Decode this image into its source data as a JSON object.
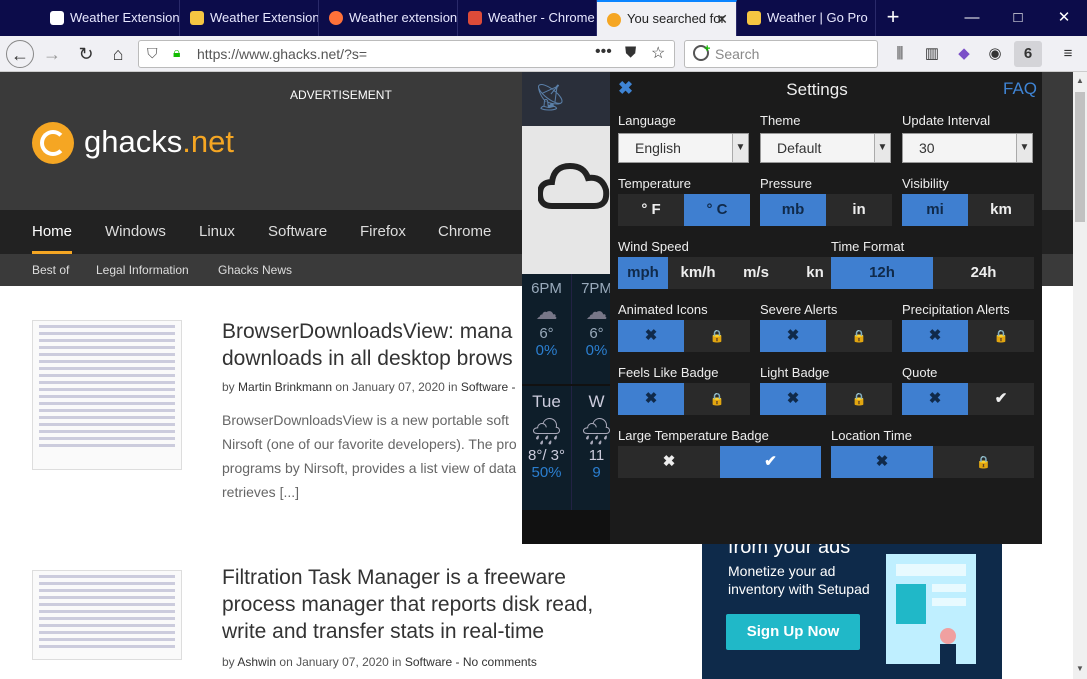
{
  "tabs": [
    {
      "label": "Weather Extension",
      "icon_color": "#ffffff",
      "active": false
    },
    {
      "label": "Weather Extension",
      "icon_color": "#f5c542",
      "active": false
    },
    {
      "label": "Weather extension",
      "icon_color": "#ff7139",
      "active": false
    },
    {
      "label": "Weather - Chrome",
      "icon_color": "#dd4b39",
      "active": false
    },
    {
      "label": "You searched for",
      "icon_color": "#f5a623",
      "active": true
    },
    {
      "label": "Weather | Go Pro",
      "icon_color": "#f5c542",
      "active": false
    }
  ],
  "window": {
    "new_tab": "+",
    "minimize": "—",
    "maximize": "□",
    "close": "✕"
  },
  "navbar": {
    "url": "https://www.ghacks.net/?s=",
    "search_placeholder": "Search",
    "badge": "6"
  },
  "page": {
    "advertisement": "ADVERTISEMENT",
    "logo_prefix": "ghacks",
    "logo_suffix": ".net",
    "nav": [
      "Home",
      "Windows",
      "Linux",
      "Software",
      "Firefox",
      "Chrome"
    ],
    "subnav": [
      "Best of",
      "Legal Information",
      "Ghacks News"
    ],
    "articles": [
      {
        "title_line1": "BrowserDownloadsView: mana",
        "title_line2": "downloads in all desktop brows",
        "by": "by",
        "author": "Martin Brinkmann",
        "on": "on January 07, 2020 in",
        "category": "Software -",
        "body": [
          "BrowserDownloadsView is a new portable soft",
          "Nirsoft (one of our favorite developers). The pro",
          "programs by Nirsoft, provides a list view of data",
          "retrieves [...]"
        ]
      },
      {
        "title_line1": "Filtration Task Manager is a freeware",
        "title_line2": "process manager that reports disk read,",
        "title_line3": "write and transfer stats in real-time",
        "by": "by",
        "author": "Ashwin",
        "on": "on January 07, 2020 in",
        "category": "Software -",
        "comments": "No comments"
      }
    ],
    "ad": {
      "headline": "from your ads",
      "sub": "Monetize your ad inventory with Setupad",
      "button": "Sign Up Now"
    }
  },
  "weather": {
    "hours": [
      {
        "time": "6PM",
        "temp": "6°",
        "precip": "0%"
      },
      {
        "time": "7PM",
        "temp": "6°",
        "precip": "0%"
      }
    ],
    "days": [
      {
        "day": "Tue",
        "temp": "8°/ 3°",
        "precip": "50%"
      },
      {
        "day": "W",
        "temp": "11",
        "precip": "9"
      }
    ]
  },
  "settings": {
    "title": "Settings",
    "faq": "FAQ",
    "close": "✖",
    "language": {
      "label": "Language",
      "value": "English"
    },
    "theme": {
      "label": "Theme",
      "value": "Default"
    },
    "update_interval": {
      "label": "Update Interval",
      "value": "30"
    },
    "temperature": {
      "label": "Temperature",
      "f": "° F",
      "c": "° C"
    },
    "pressure": {
      "label": "Pressure",
      "mb": "mb",
      "in": "in"
    },
    "visibility": {
      "label": "Visibility",
      "mi": "mi",
      "km": "km"
    },
    "wind_speed": {
      "label": "Wind Speed",
      "mph": "mph",
      "kmh": "km/h",
      "ms": "m/s",
      "kn": "kn"
    },
    "time_format": {
      "label": "Time Format",
      "h12": "12h",
      "h24": "24h"
    },
    "animated_icons": {
      "label": "Animated Icons"
    },
    "severe_alerts": {
      "label": "Severe Alerts"
    },
    "precip_alerts": {
      "label": "Precipitation Alerts"
    },
    "feels_like": {
      "label": "Feels Like Badge"
    },
    "light_badge": {
      "label": "Light Badge"
    },
    "quote": {
      "label": "Quote"
    },
    "large_temp": {
      "label": "Large Temperature Badge"
    },
    "location_time": {
      "label": "Location Time"
    },
    "glyph_x": "✖",
    "glyph_check": "✔",
    "glyph_lock": "🔒"
  },
  "colors": {
    "accent": "#3f7fd0",
    "brand": "#f5a623",
    "tabbar": "#0c0c4a"
  }
}
